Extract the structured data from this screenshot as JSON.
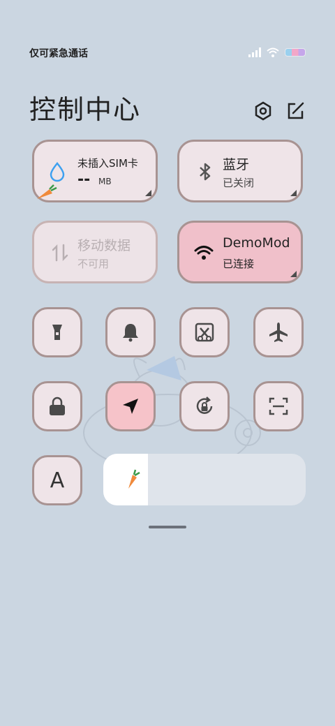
{
  "status_bar": {
    "carrier_text": "仅可紧急通话",
    "icons": [
      "signal-icon",
      "wifi-icon",
      "battery-icon"
    ]
  },
  "header": {
    "title": "控制中心",
    "settings_icon": "settings-icon",
    "edit_icon": "edit-icon"
  },
  "tiles": {
    "data_usage": {
      "title": "未插入SIM卡",
      "value": "--",
      "unit": "MB",
      "icon": "water-drop-icon"
    },
    "bluetooth": {
      "title": "蓝牙",
      "status": "已关闭",
      "icon": "bluetooth-icon"
    },
    "mobile_data": {
      "title": "移动数据",
      "status": "不可用",
      "icon": "data-arrows-icon",
      "enabled": false
    },
    "wifi": {
      "title": "DemoMod",
      "status": "已连接",
      "icon": "wifi-icon",
      "active": true
    }
  },
  "toggles": [
    {
      "icon": "flashlight-icon",
      "active": false
    },
    {
      "icon": "bell-icon",
      "active": false
    },
    {
      "icon": "screenshot-icon",
      "active": false
    },
    {
      "icon": "airplane-icon",
      "active": false
    },
    {
      "icon": "lock-icon",
      "active": false
    },
    {
      "icon": "location-icon",
      "active": true
    },
    {
      "icon": "rotation-lock-icon",
      "active": false
    },
    {
      "icon": "scanner-icon",
      "active": false
    },
    {
      "icon": "font-size-icon",
      "label": "A",
      "active": false
    }
  ],
  "brightness": {
    "level": 0.22,
    "icon": "carrot-icon"
  },
  "colors": {
    "background": "#cbd6e1",
    "tile": "#efe4e8",
    "tile_border": "#a89392",
    "active": "#f0c0ca"
  }
}
